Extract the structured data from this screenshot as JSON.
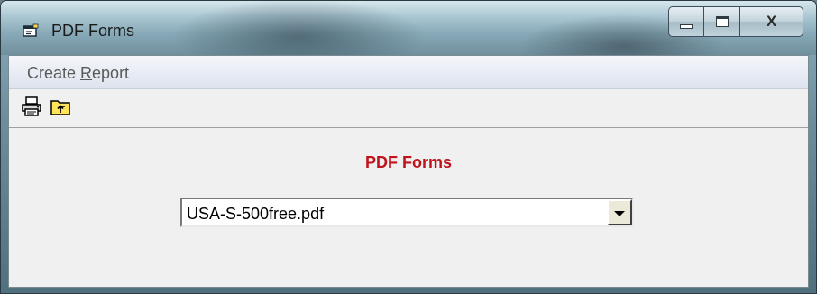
{
  "window": {
    "title": "PDF Forms"
  },
  "caption_buttons": {
    "close_label": "X"
  },
  "menu": {
    "items": [
      {
        "label_prefix": "Create ",
        "label_accel": "R",
        "label_rest": "eport"
      }
    ]
  },
  "toolbar": {
    "buttons": [
      {
        "icon": "printer-icon"
      },
      {
        "icon": "folder-up-icon"
      }
    ]
  },
  "form": {
    "heading": "PDF Forms",
    "selected_file": "USA-S-500free.pdf"
  },
  "colors": {
    "heading": "#c0141c",
    "menubar": "#dde3ee"
  }
}
